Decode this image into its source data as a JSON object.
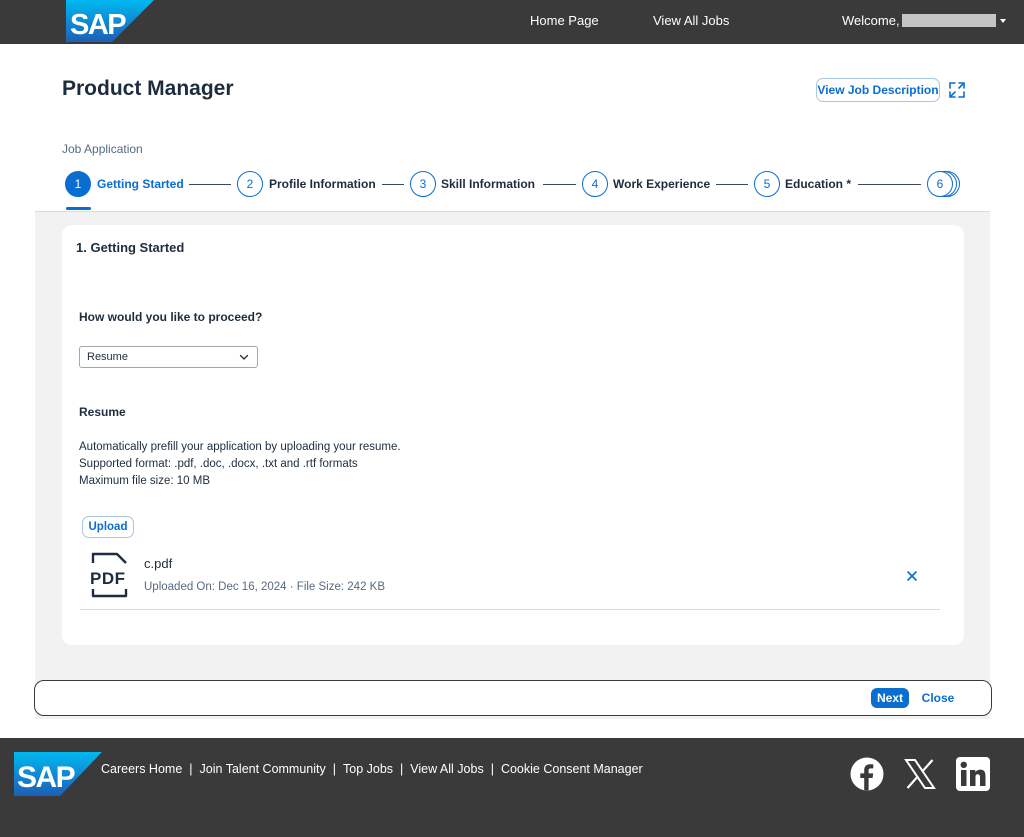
{
  "header": {
    "logo_text": "SAP",
    "nav": [
      "Home Page",
      "View All Jobs"
    ],
    "welcome": "Welcome,"
  },
  "page": {
    "job_title": "Product Manager",
    "view_description_button": "View Job Description",
    "breadcrumb": "Job Application"
  },
  "stepper": {
    "steps": [
      {
        "number": "1",
        "label": "Getting Started"
      },
      {
        "number": "2",
        "label": "Profile Information"
      },
      {
        "number": "3",
        "label": "Skill Information"
      },
      {
        "number": "4",
        "label": "Work Experience"
      },
      {
        "number": "5",
        "label": "Education *"
      },
      {
        "number": "6",
        "label": ""
      }
    ],
    "active_step": 1
  },
  "form": {
    "section_title": "1. Getting Started",
    "question": "How would you like to proceed?",
    "proceed_value": "Resume",
    "resume_heading": "Resume",
    "description_lines": [
      "Automatically prefill your application by uploading your resume.",
      "Supported format: .pdf, .doc, .docx, .txt and .rtf formats",
      "Maximum file size: 10 MB"
    ],
    "upload_button": "Upload",
    "file": {
      "icon_text": "PDF",
      "name": "c.pdf",
      "meta": "Uploaded On: Dec 16, 2024 · File Size: 242 KB"
    }
  },
  "actions": {
    "next": "Next",
    "close": "Close"
  },
  "footer": {
    "logo_text": "SAP",
    "links": [
      "Careers Home",
      "Join Talent Community",
      "Top Jobs",
      "View All Jobs",
      "Cookie Consent Manager"
    ],
    "separator": "|",
    "social_icons": [
      "facebook-icon",
      "x-icon",
      "linkedin-icon"
    ]
  },
  "colors": {
    "header_bg": "#3a3a3a",
    "accent": "#0a6ed1",
    "logo_gradient_start": "#00b8f1",
    "logo_gradient_end": "#1e5fb5",
    "content_bg": "#f2f2f2",
    "text": "#1d2d3e"
  }
}
